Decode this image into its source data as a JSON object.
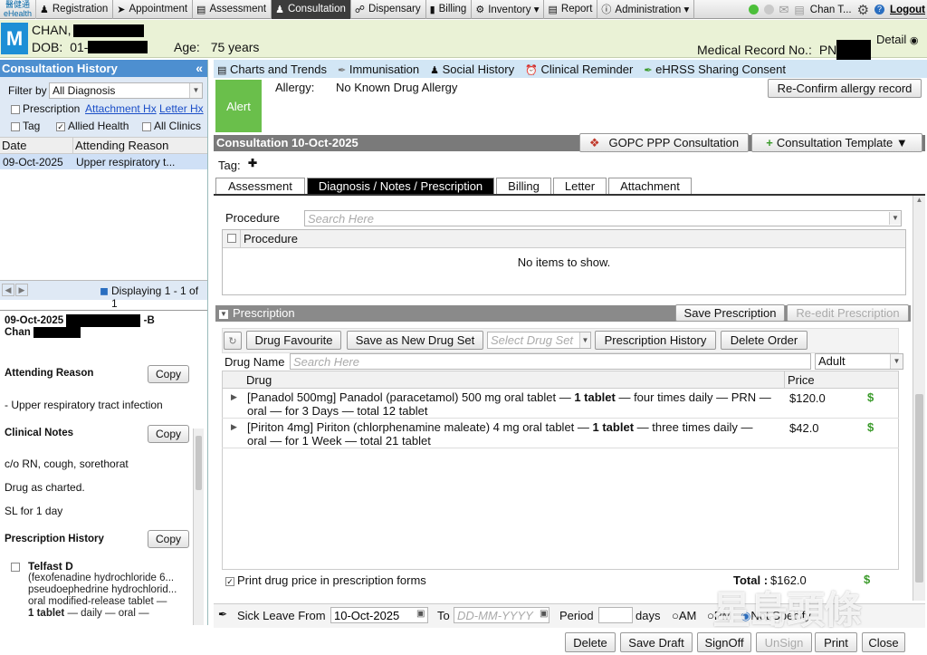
{
  "topbar": {
    "logo_line1": "醫健通",
    "logo_line2": "eHealth",
    "menus": [
      {
        "label": "Registration",
        "icon": "person-icon",
        "glyph": "👤"
      },
      {
        "label": "Appointment",
        "icon": "pin-icon",
        "glyph": "📌"
      },
      {
        "label": "Assessment",
        "icon": "clipboard-icon",
        "glyph": "📋"
      },
      {
        "label": "Consultation",
        "icon": "doctor-icon",
        "glyph": "👤"
      },
      {
        "label": "Dispensary",
        "icon": "pill-icon",
        "glyph": "💊"
      },
      {
        "label": "Billing",
        "icon": "billing-icon",
        "glyph": "▮"
      },
      {
        "label": "Inventory ▾",
        "icon": "gear-icon",
        "glyph": "⚙"
      },
      {
        "label": "Report",
        "icon": "report-icon",
        "glyph": "📄"
      },
      {
        "label": "Administration ▾",
        "icon": "info-icon",
        "glyph": "ℹ"
      }
    ],
    "user": "Chan T...",
    "logout": "Logout"
  },
  "patient": {
    "badge": "M",
    "name": "CHAN,",
    "dob_label": "DOB:",
    "dob": "01-",
    "age_label": "Age:",
    "age": "75 years",
    "mrn_label": "Medical Record No.:",
    "mrn": "PN",
    "detail": "Detail"
  },
  "history": {
    "title": "Consultation History",
    "filter_label": "Filter by",
    "filter_value": "All Diagnosis",
    "checks": [
      {
        "label": "Prescription",
        "checked": false
      },
      {
        "label": "Tag",
        "checked": false
      },
      {
        "label": "Allied Health",
        "checked": true
      },
      {
        "label": "All Clinics",
        "checked": false
      }
    ],
    "attachment_link": "Attachment Hx",
    "letter_link": "Letter Hx",
    "col_date": "Date",
    "col_reason": "Attending Reason",
    "rows": [
      {
        "date": "09-Oct-2025",
        "reason": "Upper respiratory t..."
      }
    ],
    "displaying": "Displaying 1 - 1 of 1"
  },
  "detail": {
    "date": "09-Oct-2025",
    "suffix": "-B",
    "name": "Chan",
    "attending_reason_label": "Attending Reason",
    "attending_reason": "- Upper respiratory tract infection",
    "clinical_notes_label": "Clinical Notes",
    "notes": [
      "c/o RN, cough, sorethorat",
      "Drug as charted.",
      "SL for 1 day"
    ],
    "prescription_history_label": "Prescription History",
    "copy": "Copy",
    "rx_name": "Telfast D",
    "rx_desc_1": "(fexofenadine hydrochloride 6...",
    "rx_desc_2": "pseudoephedrine hydrochlorid...",
    "rx_desc_3": "oral modified-release tablet —",
    "rx_desc_4_bold": "1 tablet",
    "rx_desc_4_rest": " — daily — oral —"
  },
  "subnav": [
    "Charts and Trends",
    "Immunisation",
    "Social History",
    "Clinical Reminder",
    "eHRSS Sharing Consent"
  ],
  "alert": {
    "label": "Alert",
    "allergy_label": "Allergy:",
    "allergy": "No Known Drug Allergy",
    "reconfirm": "Re-Confirm allergy record"
  },
  "consultation": {
    "title": "Consultation 10-Oct-2025",
    "gopc": "GOPC PPP Consultation",
    "template": "Consultation Template ▼",
    "tag_label": "Tag:",
    "tabs": [
      "Assessment",
      "Diagnosis / Notes / Prescription",
      "Billing",
      "Letter",
      "Attachment"
    ],
    "active_tab": 1
  },
  "procedure": {
    "label": "Procedure",
    "placeholder": "Search Here",
    "col": "Procedure",
    "empty": "No items to show."
  },
  "prescription": {
    "title": "Prescription",
    "save": "Save Prescription",
    "reedit": "Re-edit Prescription",
    "drug_favourite": "Drug Favourite",
    "save_new_set": "Save as New Drug Set",
    "select_set_placeholder": "Select Drug Set",
    "history": "Prescription History",
    "delete_order": "Delete Order",
    "drug_name_label": "Drug Name",
    "drug_name_placeholder": "Search Here",
    "age_group": "Adult",
    "col_drug": "Drug",
    "col_price": "Price",
    "items": [
      {
        "pre": "[Panadol 500mg] Panadol (paracetamol) 500 mg oral tablet — ",
        "bold": "1 tablet",
        "post": " — four times daily — PRN —",
        "line2": "oral — for 3 Days — total 12 tablet",
        "price": "$120.0"
      },
      {
        "pre": "[Piriton 4mg] Piriton (chlorphenamine maleate) 4 mg oral tablet — ",
        "bold": "1 tablet",
        "post": " — three times daily —",
        "line2": "oral — for 1 Week — total 21 tablet",
        "price": "$42.0"
      }
    ],
    "print_price": "Print drug price in prescription forms",
    "total_label": "Total :",
    "total": "$162.0"
  },
  "sickleave": {
    "from_label": "Sick Leave From",
    "from": "10-Oct-2025",
    "to_label": "To",
    "to_placeholder": "DD-MM-YYYY",
    "period_label": "Period",
    "days": "days",
    "am": "AM",
    "pm": "PM",
    "not_specify": "Not Specify"
  },
  "footer": [
    "Delete",
    "Save Draft",
    "SignOff",
    "UnSign",
    "Print",
    "Close"
  ],
  "watermark": "星島頭條",
  "colors": {
    "accent_blue": "#4d8fd0",
    "alert_green": "#6abf4b",
    "badge_blue": "#1d8fd6"
  }
}
